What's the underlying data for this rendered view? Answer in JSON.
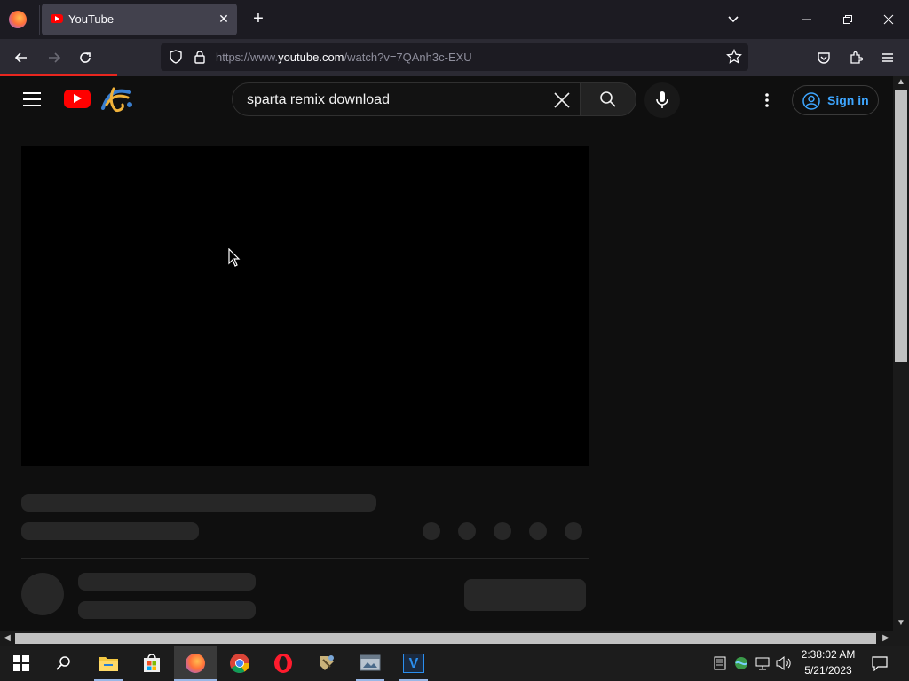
{
  "browser": {
    "tab_title": "YouTube",
    "url_prefix": "https://www.",
    "url_domain": "youtube.com",
    "url_path": "/watch?v=7QAnh3c-EXU"
  },
  "youtube": {
    "search_value": "sparta remix download",
    "sign_in_label": "Sign in"
  },
  "taskbar": {
    "time": "2:38:02 AM",
    "date": "5/21/2023"
  },
  "colors": {
    "accent_red": "#ff0000",
    "link_blue": "#3ea6ff",
    "background": "#0f0f0f"
  }
}
